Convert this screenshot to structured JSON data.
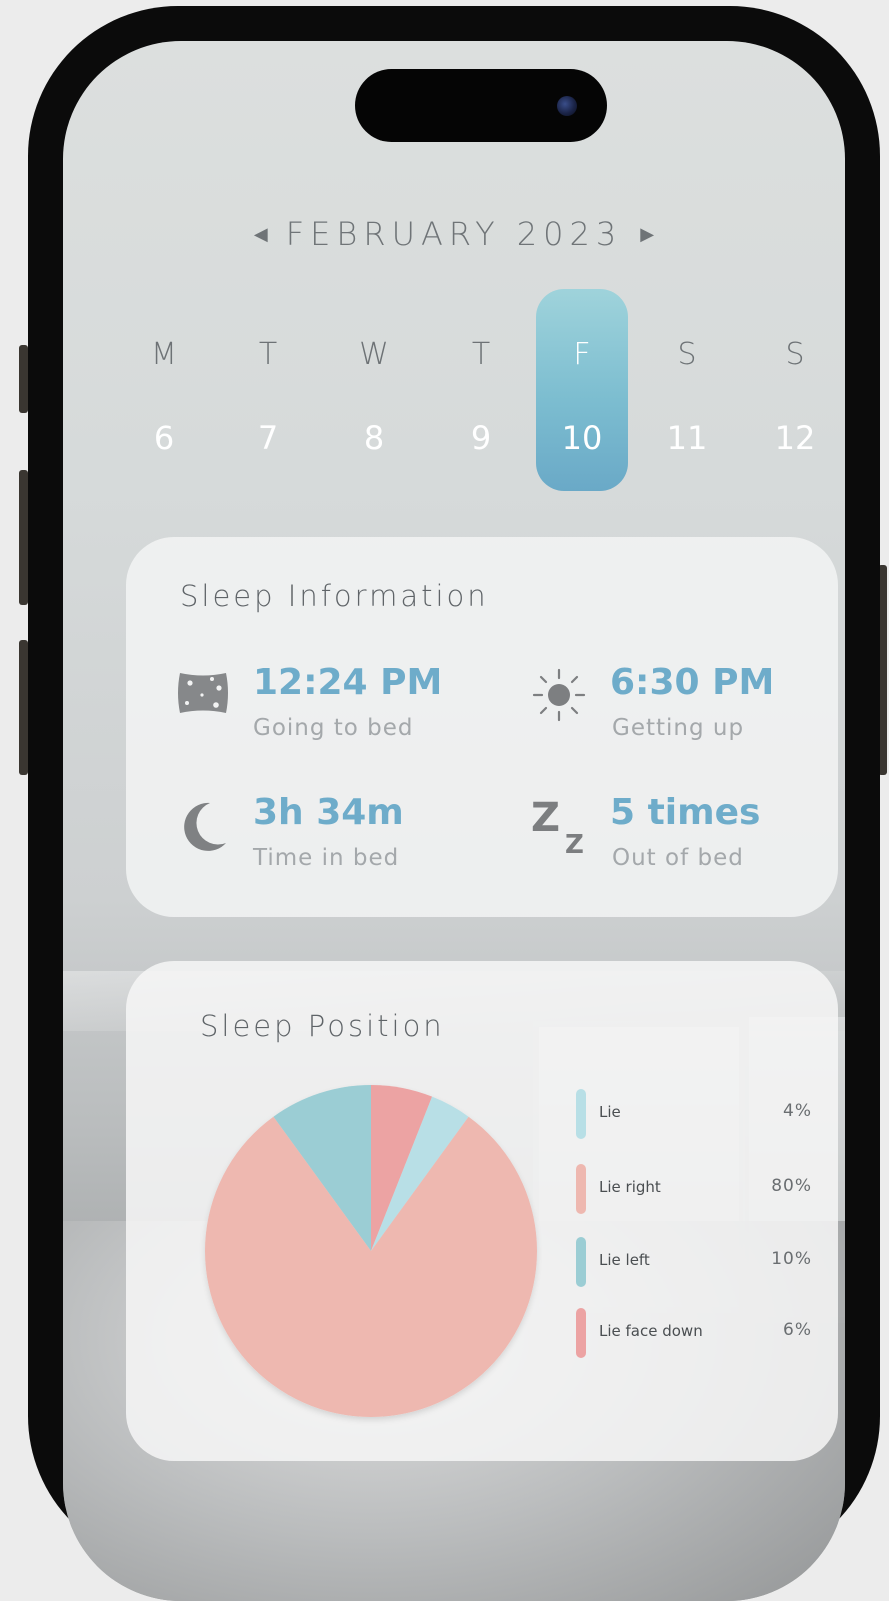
{
  "calendar": {
    "month_label": "FEBRUARY 2023",
    "days": [
      {
        "letter": "M",
        "num": "6"
      },
      {
        "letter": "T",
        "num": "7"
      },
      {
        "letter": "W",
        "num": "8"
      },
      {
        "letter": "T",
        "num": "9"
      },
      {
        "letter": "F",
        "num": "10",
        "selected": true
      },
      {
        "letter": "S",
        "num": "11"
      },
      {
        "letter": "S",
        "num": "12"
      }
    ]
  },
  "sleep_info": {
    "title": "Sleep Information",
    "bed_time": {
      "value": "12:24 PM",
      "label": "Going to bed",
      "icon": "pillow-icon"
    },
    "wake_time": {
      "value": "6:30 PM",
      "label": "Getting up",
      "icon": "sun-icon"
    },
    "time_in_bed": {
      "value": "3h 34m",
      "label": "Time in bed",
      "icon": "moon-icon"
    },
    "out_of_bed": {
      "value": "5 times",
      "label": "Out of bed",
      "icon": "zz-icon"
    }
  },
  "sleep_position": {
    "title": "Sleep Position",
    "legend": [
      {
        "name": "Lie",
        "value": "4%"
      },
      {
        "name": "Lie right",
        "value": "80%"
      },
      {
        "name": "Lie left",
        "value": "10%"
      },
      {
        "name": "Lie face down",
        "value": "6%"
      }
    ]
  },
  "colors": {
    "accent": "#6eacca",
    "lie": "#b8dfe6",
    "lie_right": "#eeb8b0",
    "lie_left": "#9bcdd4",
    "lie_face_down": "#eca3a3"
  },
  "chart_data": {
    "type": "pie",
    "title": "Sleep Position",
    "categories": [
      "Lie",
      "Lie right",
      "Lie left",
      "Lie face down"
    ],
    "values": [
      4,
      80,
      10,
      6
    ],
    "legend": "right"
  }
}
